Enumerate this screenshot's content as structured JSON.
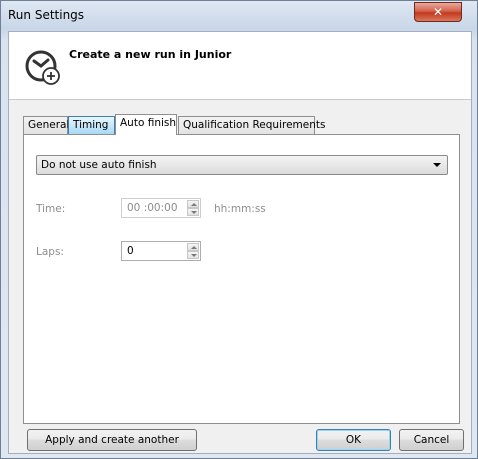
{
  "window": {
    "title": "Run Settings",
    "close_glyph": "✕"
  },
  "header": {
    "title": "Create a new run in Junior",
    "icon": "stopwatch-add-icon"
  },
  "tabs": [
    {
      "label": "General"
    },
    {
      "label": "Timing"
    },
    {
      "label": "Auto finish"
    },
    {
      "label": "Qualification Requirements"
    }
  ],
  "active_tab": "Auto finish",
  "auto_finish": {
    "mode_selected": "Do not use auto finish",
    "time_label": "Time:",
    "time_value": "00 :00:00",
    "time_hint": "hh:mm:ss",
    "laps_label": "Laps:",
    "laps_value": "0"
  },
  "buttons": {
    "apply_create_another": "Apply and create another",
    "ok": "OK",
    "cancel": "Cancel"
  },
  "colors": {
    "window_frame": "#c8d6e8",
    "close_button": "#c4391f",
    "tab_hover": "#a7d9f5"
  }
}
